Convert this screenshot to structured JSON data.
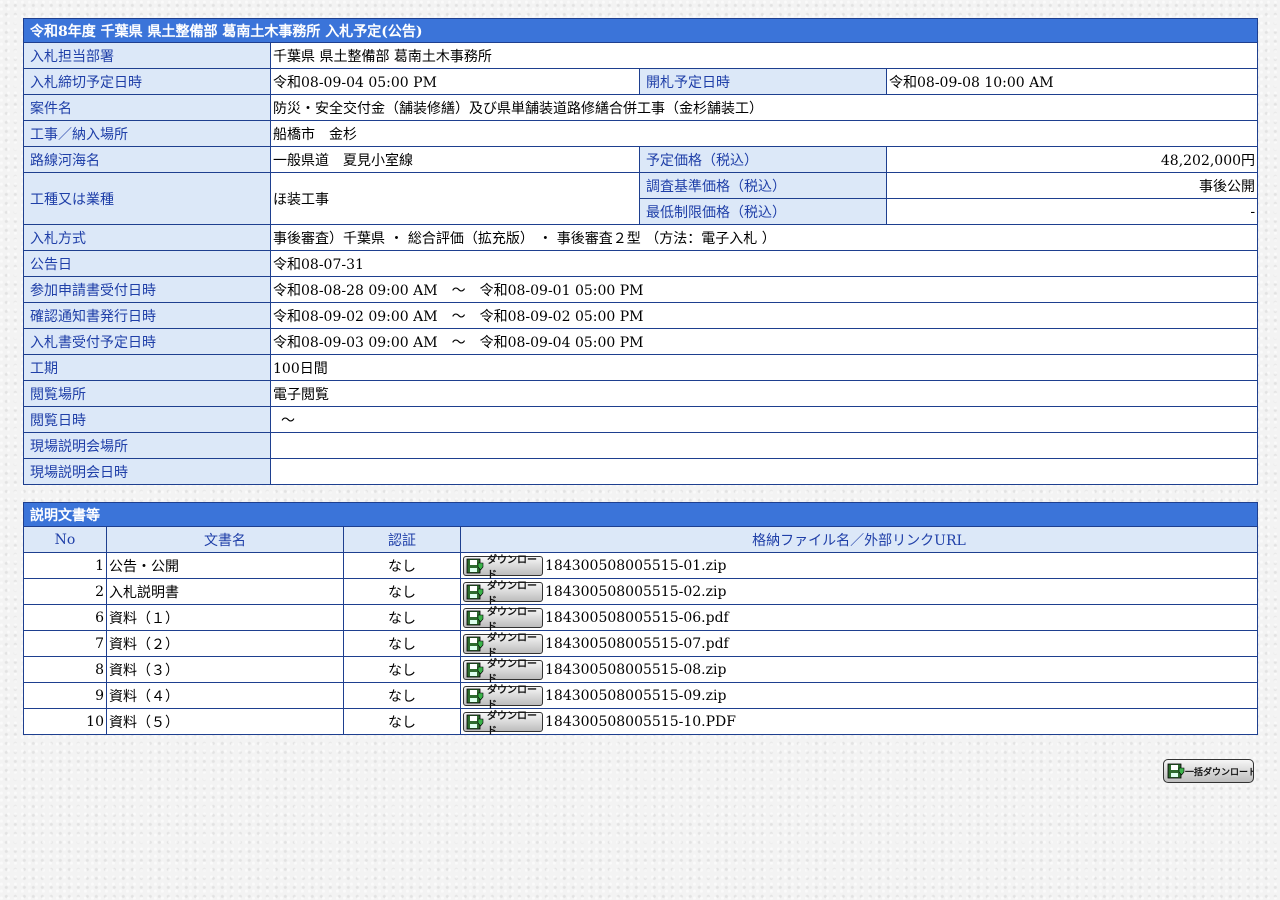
{
  "notice": {
    "title": "令和8年度 千葉県 県土整備部 葛南土木事務所 入札予定(公告)",
    "rows": {
      "dept": {
        "label": "入札担当部署",
        "value": "千葉県 県土整備部 葛南土木事務所"
      },
      "deadline": {
        "label": "入札締切予定日時",
        "value": "令和08-09-04 05:00 PM"
      },
      "opening": {
        "label": "開札予定日時",
        "value": "令和08-09-08 10:00 AM"
      },
      "project": {
        "label": "案件名",
        "value": "防災・安全交付金（舗装修繕）及び県単舗装道路修繕合併工事（金杉舗装工）"
      },
      "place": {
        "label": "工事／納入場所",
        "value": "船橋市　金杉"
      },
      "route": {
        "label": "路線河海名",
        "value": "一般県道　夏見小室線"
      },
      "price": {
        "label": "予定価格（税込）",
        "value": "48,202,000円"
      },
      "category": {
        "label": "工種又は業種",
        "value": "ほ装工事"
      },
      "survey_price": {
        "label": "調査基準価格（税込）",
        "value": "事後公開"
      },
      "min_price": {
        "label": "最低制限価格（税込）",
        "value": "-"
      },
      "method": {
        "label": "入札方式",
        "value": "事後審査）千葉県 ・ 総合評価（拡充版） ・ 事後審査２型 （方法：電子入札 ）"
      },
      "announce": {
        "label": "公告日",
        "value": "令和08-07-31"
      },
      "apply": {
        "label": "参加申請書受付日時",
        "value": "令和08-08-28 09:00 AM　～　令和08-09-01 05:00 PM"
      },
      "confirm": {
        "label": "確認通知書発行日時",
        "value": "令和08-09-02 09:00 AM　～　令和08-09-02 05:00 PM"
      },
      "bid_accept": {
        "label": "入札書受付予定日時",
        "value": "令和08-09-03 09:00 AM　～　令和08-09-04 05:00 PM"
      },
      "period": {
        "label": "工期",
        "value": "100日間"
      },
      "view_place": {
        "label": "閲覧場所",
        "value": "電子閲覧"
      },
      "view_time": {
        "label": "閲覧日時",
        "value": "～"
      },
      "site_place": {
        "label": "現場説明会場所",
        "value": ""
      },
      "site_time": {
        "label": "現場説明会日時",
        "value": ""
      }
    }
  },
  "docs": {
    "title": "説明文書等",
    "headers": {
      "no": "No",
      "name": "文書名",
      "auth": "認証",
      "file": "格納ファイル名／外部リンクURL"
    },
    "download_label": "ダウンロード",
    "items": [
      {
        "no": "1",
        "name": "公告・公開",
        "auth": "なし",
        "file": "184300508005515-01.zip"
      },
      {
        "no": "2",
        "name": "入札説明書",
        "auth": "なし",
        "file": "184300508005515-02.zip"
      },
      {
        "no": "6",
        "name": "資料（１）",
        "auth": "なし",
        "file": "184300508005515-06.pdf"
      },
      {
        "no": "7",
        "name": "資料（２）",
        "auth": "なし",
        "file": "184300508005515-07.pdf"
      },
      {
        "no": "8",
        "name": "資料（３）",
        "auth": "なし",
        "file": "184300508005515-08.zip"
      },
      {
        "no": "9",
        "name": "資料（４）",
        "auth": "なし",
        "file": "184300508005515-09.zip"
      },
      {
        "no": "10",
        "name": "資料（５）",
        "auth": "なし",
        "file": "184300508005515-10.PDF"
      }
    ]
  },
  "bulk_download_label": "一括ダウンロード",
  "icons": {
    "download": "floppy-download-icon"
  },
  "colors": {
    "header_bg": "#3b74d9",
    "label_bg": "#dce8f8",
    "label_text": "#1f3fa8",
    "border": "#1e3f8f"
  }
}
